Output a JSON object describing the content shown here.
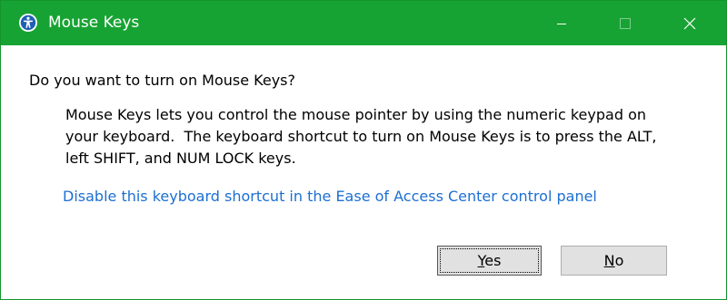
{
  "window": {
    "title": "Mouse Keys",
    "icon": "ease-of-access-icon",
    "controls": {
      "minimize": "minimize-icon",
      "maximize": "maximize-icon",
      "close": "close-icon"
    }
  },
  "dialog": {
    "question": "Do you want to turn on Mouse Keys?",
    "description_lines": [
      "Mouse Keys lets you control the mouse pointer by using the numeric keypad on",
      "your keyboard.  The keyboard shortcut to turn on Mouse Keys is to press the ALT,",
      "left SHIFT, and NUM LOCK keys."
    ],
    "link_text": "Disable this keyboard shortcut in the Ease of Access Center control panel"
  },
  "buttons": {
    "yes_accel": "Y",
    "yes_rest": "es",
    "no_accel": "N",
    "no_rest": "o"
  },
  "colors": {
    "titlebar": "#17a333",
    "border": "#14952d",
    "link": "#1d6fd1",
    "button_face": "#e1e1e1"
  }
}
